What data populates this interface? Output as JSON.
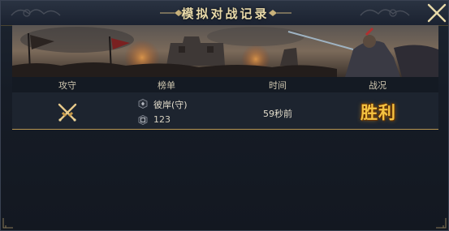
{
  "dialog": {
    "title": "模拟对战记录"
  },
  "table": {
    "columns": [
      "攻守",
      "榜单",
      "时间",
      "战况"
    ],
    "rows": [
      {
        "attack_defense_icon": "crossed-swords-icon",
        "ranking_name": "彼岸(守)",
        "ranking_score": "123",
        "time": "59秒前",
        "result": "胜利"
      }
    ]
  },
  "colors": {
    "title_text": "#e8d9a8",
    "result_text": "#f4c342",
    "row_divider": "#b89652",
    "header_text": "#cfc7b0"
  }
}
